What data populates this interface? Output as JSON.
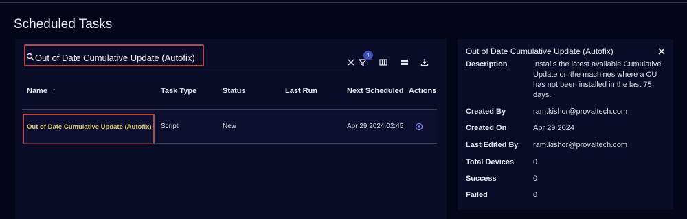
{
  "page": {
    "title": "Scheduled Tasks"
  },
  "search": {
    "value": "Out of Date Cumulative Update (Autofix)"
  },
  "toolbar": {
    "filter_count": "1"
  },
  "table": {
    "columns": {
      "name": "Name",
      "task_type": "Task Type",
      "status": "Status",
      "last_run": "Last Run",
      "next_scheduled": "Next Scheduled",
      "actions": "Actions"
    },
    "sort_indicator": "↑",
    "rows": [
      {
        "name": "Out of Date Cumulative Update (Autofix)",
        "task_type": "Script",
        "status": "New",
        "last_run": "",
        "next_scheduled": "Apr 29 2024 02:45"
      }
    ]
  },
  "details": {
    "title": "Out of Date Cumulative Update (Autofix)",
    "fields": [
      {
        "label": "Description",
        "value": "Installs the latest available Cumulative Update on the machines where a CU has not been installed in the last 75 days."
      },
      {
        "label": "Created By",
        "value": "ram.kishor@provaltech.com"
      },
      {
        "label": "Created On",
        "value": "Apr 29 2024"
      },
      {
        "label": "Last Edited By",
        "value": "ram.kishor@provaltech.com"
      },
      {
        "label": "Total Devices",
        "value": "0"
      },
      {
        "label": "Success",
        "value": "0"
      },
      {
        "label": "Failed",
        "value": "0"
      }
    ]
  },
  "colors": {
    "background": "#05051a",
    "panel": "#0b0c28",
    "highlight": "#b34a47",
    "task_name": "#d8c86a",
    "badge": "#3b4fb8"
  },
  "icons": [
    "search-icon",
    "close-icon",
    "filter-icon",
    "columns-icon",
    "density-icon",
    "download-icon",
    "settings-icon"
  ]
}
